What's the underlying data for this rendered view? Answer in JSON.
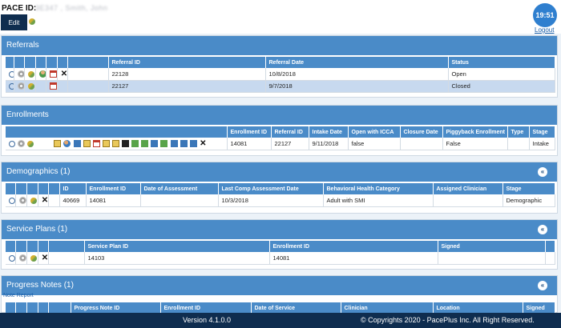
{
  "header": {
    "pace_label": "PACE ID:",
    "pace_name": "3E347 , Smith, John",
    "edit_label": "Edit",
    "clock": "19:51",
    "logout": "Logout"
  },
  "referrals": {
    "title": "Referrals",
    "columns": [
      "Referral ID",
      "Referral Date",
      "Status"
    ],
    "rows": [
      {
        "id": "22128",
        "date": "10/8/2018",
        "status": "Open"
      },
      {
        "id": "22127",
        "date": "9/7/2018",
        "status": "Closed"
      }
    ]
  },
  "enrollments": {
    "title": "Enrollments",
    "columns": [
      "Enrollment ID",
      "Referral ID",
      "Intake Date",
      "Open with ICCA",
      "Closure Date",
      "Piggyback Enrollment",
      "Type",
      "Stage"
    ],
    "rows": [
      {
        "enrollment_id": "14081",
        "referral_id": "22127",
        "intake_date": "9/11/2018",
        "open_icca": "false",
        "closure_date": "",
        "piggyback": "False",
        "type": "",
        "stage": "Intake"
      }
    ]
  },
  "demographics": {
    "title": "Demographics (1)",
    "collapse": "«",
    "columns": [
      "ID",
      "Enrollment ID",
      "Date of Assessment",
      "Last Comp Assessment Date",
      "Behavioral Health Category",
      "Assigned Clinician",
      "Stage"
    ],
    "rows": [
      {
        "id": "40669",
        "enrollment_id": "14081",
        "date_assessment": "",
        "last_comp": "10/3/2018",
        "category": "Adult with SMI",
        "clinician": "",
        "stage": "Demographic"
      }
    ]
  },
  "service_plans": {
    "title": "Service Plans (1)",
    "collapse": "«",
    "columns": [
      "Service Plan ID",
      "Enrollment ID",
      "Signed"
    ],
    "rows": [
      {
        "plan_id": "14103",
        "enrollment_id": "14081",
        "signed": ""
      }
    ]
  },
  "progress_notes": {
    "title": "Progress Notes (1)",
    "collapse": "«",
    "note_report": "Note Report",
    "columns": [
      "Progress Note ID",
      "Enrollment ID",
      "Date of Service",
      "Clinician",
      "Location",
      "Signed"
    ]
  },
  "footer": {
    "version": "Version 4.1.0.0",
    "copyright": "© Copyrights  2020  - PacePlus  Inc. All Right Reserved."
  }
}
